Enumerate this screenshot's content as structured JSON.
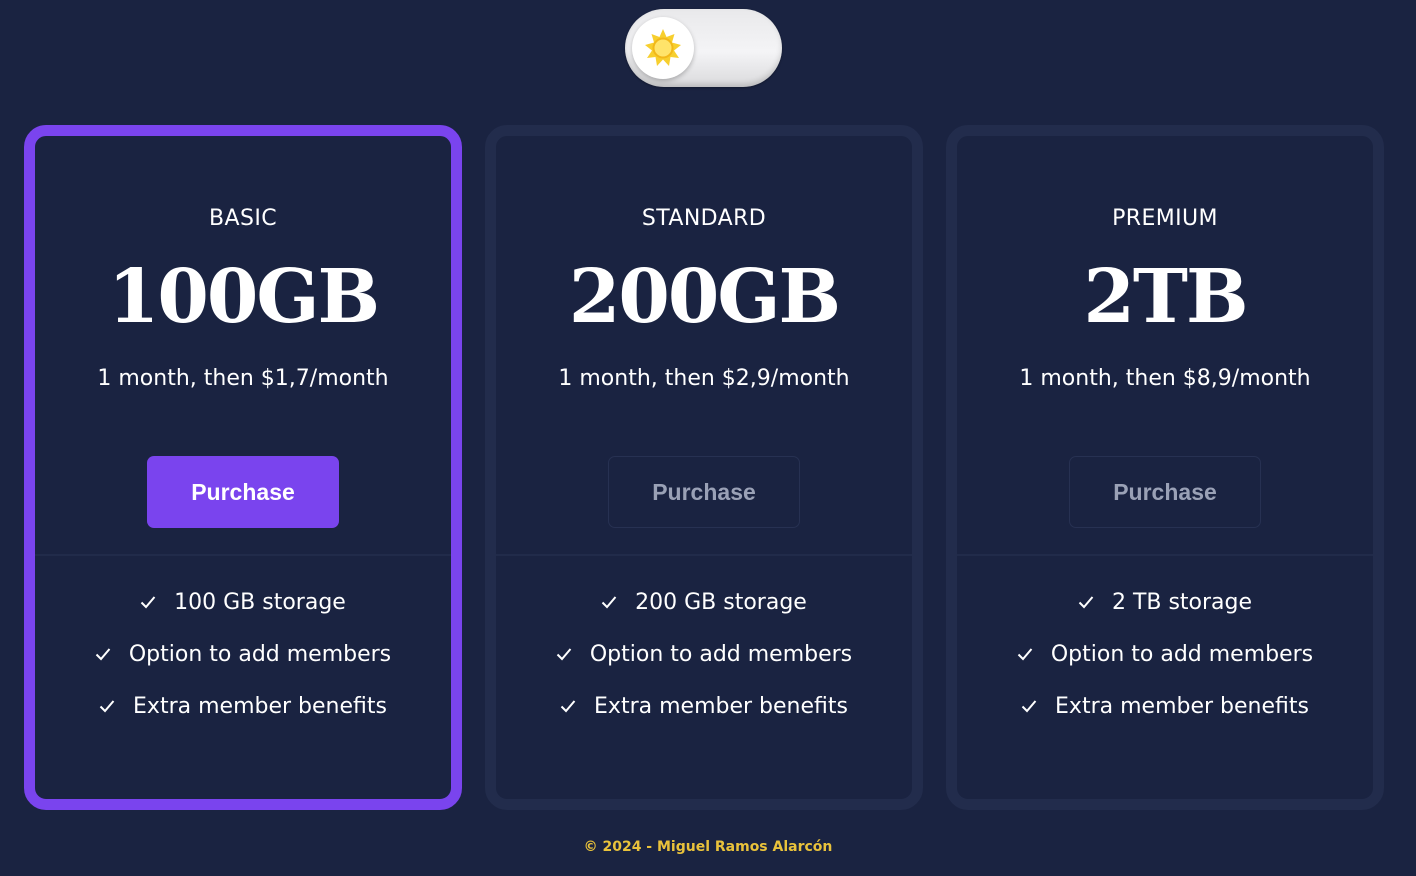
{
  "theme_toggle": {
    "icon": "sun-icon",
    "mode": "light"
  },
  "colors": {
    "background": "#1a2341",
    "card_border": "#222c4c",
    "accent": "#7a44ee",
    "footer_text": "#e9c23b"
  },
  "plans": [
    {
      "name": "BASIC",
      "capacity": "100GB",
      "price": "1 month, then $1,7/month",
      "button_label": "Purchase",
      "featured": true,
      "features": [
        "100 GB storage",
        "Option to add members",
        "Extra member benefits"
      ]
    },
    {
      "name": "STANDARD",
      "capacity": "200GB",
      "price": "1 month, then $2,9/month",
      "button_label": "Purchase",
      "featured": false,
      "features": [
        "200 GB storage",
        "Option to add members",
        "Extra member benefits"
      ]
    },
    {
      "name": "PREMIUM",
      "capacity": "2TB",
      "price": "1 month, then $8,9/month",
      "button_label": "Purchase",
      "featured": false,
      "features": [
        "2 TB storage",
        "Option to add members",
        "Extra member benefits"
      ]
    }
  ],
  "footer": {
    "text": "© 2024 - Miguel Ramos Alarcón"
  }
}
